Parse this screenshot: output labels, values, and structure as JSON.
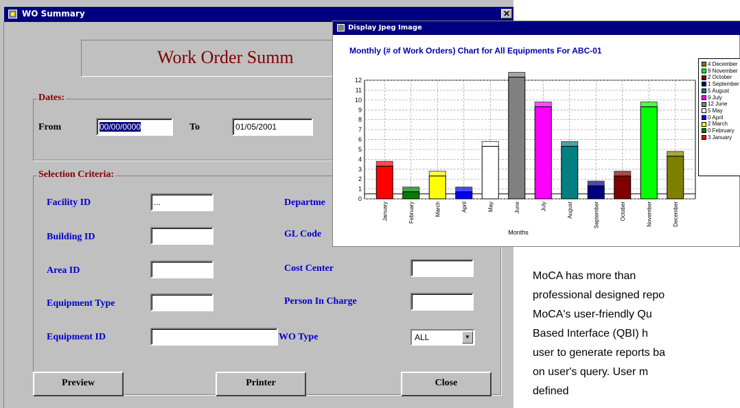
{
  "wo_window": {
    "title": "WO Summary",
    "close_glyph": "✕",
    "heading": "Work Order Summ",
    "dates": {
      "label": "Dates:",
      "from_label": "From",
      "from_value": "00/00/0000",
      "to_label": "To",
      "to_value": "01/05/2001"
    },
    "selection": {
      "label": "Selection Criteria:",
      "facility_id": {
        "label": "Facility ID",
        "value": "..."
      },
      "building_id": {
        "label": "Building ID",
        "value": ""
      },
      "area_id": {
        "label": "Area ID",
        "value": ""
      },
      "equipment_type": {
        "label": "Equipment Type",
        "value": ""
      },
      "equipment_id": {
        "label": "Equipment ID",
        "value": ""
      },
      "department": {
        "label": "Departme"
      },
      "gl_code": {
        "label": "GL Code"
      },
      "cost_center": {
        "label": "Cost Center",
        "value": ""
      },
      "person_in_charge": {
        "label": "Person In Charge",
        "value": ""
      },
      "wo_type": {
        "label": "WO Type",
        "value": "ALL"
      }
    },
    "buttons": {
      "preview": "Preview",
      "printer": "Printer",
      "close": "Close"
    }
  },
  "jpeg_window": {
    "title": "Display Jpeg Image"
  },
  "chart_data": {
    "type": "bar",
    "title": "Monthly (# of Work Orders) Chart for All Equipments For ABC-01",
    "xlabel": "Months",
    "ylabel": "",
    "ylim": [
      0,
      12
    ],
    "yticks": [
      0,
      1,
      2,
      3,
      4,
      5,
      6,
      7,
      8,
      9,
      10,
      11,
      12
    ],
    "grid": true,
    "legend_position": "right",
    "categories": [
      "January",
      "February",
      "March",
      "April",
      "May",
      "June",
      "July",
      "August",
      "September",
      "October",
      "November",
      "December"
    ],
    "values": [
      3,
      0,
      2,
      0,
      5,
      12,
      9,
      5,
      1,
      2,
      9,
      4
    ],
    "colors": [
      "#ff0000",
      "#008000",
      "#ffff00",
      "#0000ff",
      "#ffffff",
      "#808080",
      "#ff00ff",
      "#008080",
      "#000080",
      "#800000",
      "#00ff00",
      "#808000"
    ],
    "legend": [
      "4 December",
      "9 November",
      "2 October",
      "1 September",
      "5 August",
      "9 July",
      "12 June",
      "5 May",
      "0 April",
      "2 March",
      "0 February",
      "3 January"
    ],
    "legend_colors": [
      "#808000",
      "#00ff00",
      "#800000",
      "#000080",
      "#008080",
      "#ff00ff",
      "#808080",
      "#ffffff",
      "#0000ff",
      "#ffff00",
      "#008000",
      "#ff0000"
    ]
  },
  "description": {
    "lines": [
      "MoCA has more than",
      "professional designed repo",
      "MoCA's user-friendly Qu",
      "Based Interface (QBI) h",
      "user to generate reports ba",
      "on user's query. User m",
      "defined"
    ]
  }
}
